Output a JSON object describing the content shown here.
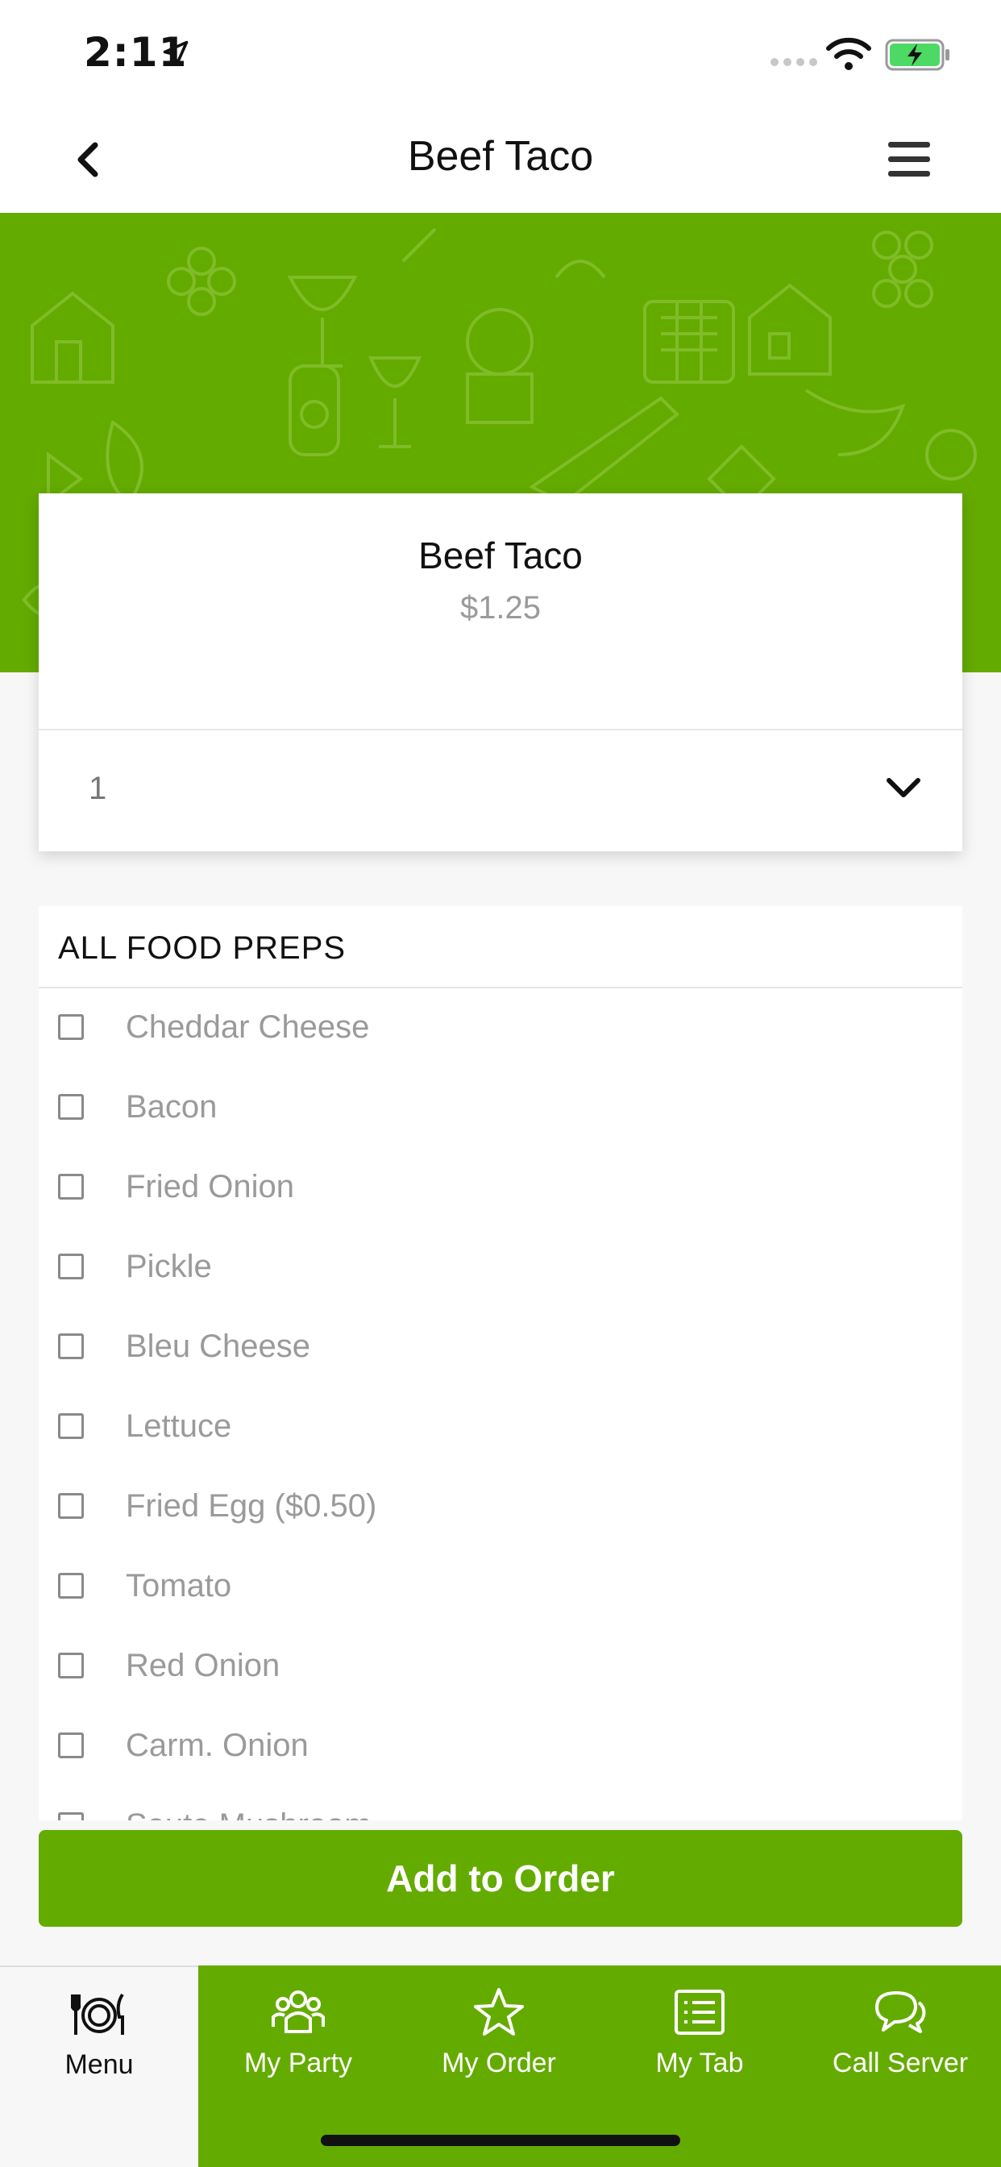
{
  "status_bar": {
    "time": "2:11"
  },
  "nav": {
    "title": "Beef Taco"
  },
  "item": {
    "name": "Beef Taco",
    "price": "$1.25",
    "quantity": "1"
  },
  "preps": {
    "title": "ALL FOOD PREPS",
    "items": [
      {
        "label": "Cheddar Cheese",
        "checked": false
      },
      {
        "label": "Bacon",
        "checked": false
      },
      {
        "label": "Fried Onion",
        "checked": false
      },
      {
        "label": "Pickle",
        "checked": false
      },
      {
        "label": "Bleu Cheese",
        "checked": false
      },
      {
        "label": "Lettuce",
        "checked": false
      },
      {
        "label": "Fried Egg ($0.50)",
        "checked": false
      },
      {
        "label": "Tomato",
        "checked": false
      },
      {
        "label": "Red Onion",
        "checked": false
      },
      {
        "label": "Carm. Onion",
        "checked": false
      },
      {
        "label": "Saute Mushroom",
        "checked": false
      }
    ]
  },
  "actions": {
    "add_to_order": "Add to Order"
  },
  "tabs": [
    {
      "label": "Menu",
      "icon": "menu-plate-icon",
      "active": true
    },
    {
      "label": "My Party",
      "icon": "party-icon",
      "active": false
    },
    {
      "label": "My Order",
      "icon": "star-icon",
      "active": false
    },
    {
      "label": "My Tab",
      "icon": "list-icon",
      "active": false
    },
    {
      "label": "Call Server",
      "icon": "chat-icon",
      "active": false
    }
  ],
  "colors": {
    "accent": "#64ab00",
    "muted_text": "#9a9a9a"
  }
}
